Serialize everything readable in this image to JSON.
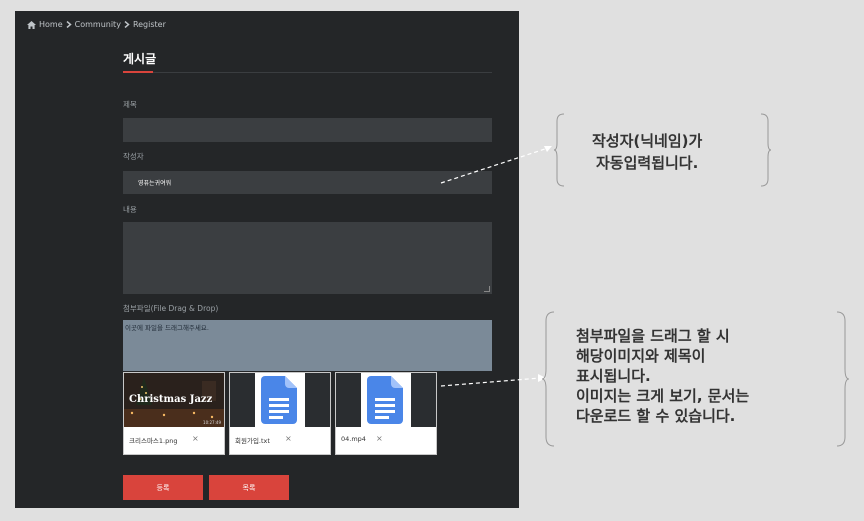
{
  "breadcrumb": {
    "home": "Home",
    "community": "Community",
    "register": "Register"
  },
  "form": {
    "title": "게시글",
    "subject_label": "제목",
    "subject_value": "",
    "author_label": "작성자",
    "author_value": "영퓨는귀여워",
    "content_label": "내용",
    "attach_label": "첨부파일(File Drag & Drop)",
    "dropzone_hint": "이곳에 파일을 드래그해주세요.",
    "files": [
      {
        "name": "크리스마스1.png",
        "thumb_text": "Christmas Jazz",
        "thumb_sub": "10:27:49",
        "type": "image"
      },
      {
        "name": "회원가입.txt",
        "type": "document"
      },
      {
        "name": "04.mp4",
        "type": "document"
      }
    ],
    "remove_symbol": "×",
    "submit_label": "등록",
    "list_label": "목록"
  },
  "annotations": {
    "author_note": [
      "작성자(닉네임)가",
      "자동입력됩니다."
    ],
    "attach_note": [
      "첨부파일을 드래그 할 시",
      "해당이미지와 제목이",
      "표시됩니다.",
      "이미지는 크게 보기, 문서는",
      "다운로드 할 수 있습니다."
    ]
  },
  "colors": {
    "panel": "#242628",
    "accent": "#d9443c",
    "field": "#3b3e41",
    "dropzone": "#7b8a98",
    "doc_blue": "#4a86e8"
  }
}
